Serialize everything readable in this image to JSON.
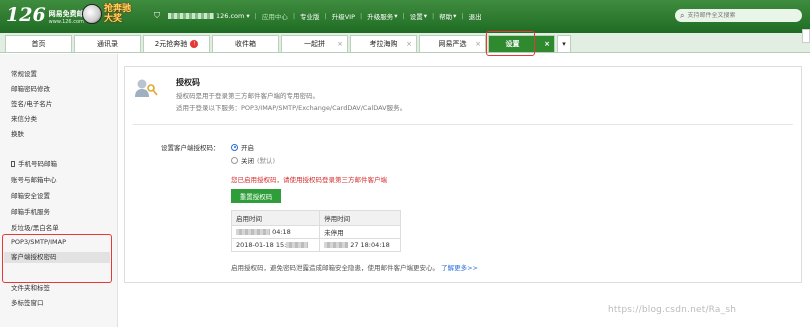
{
  "header": {
    "logo_number": "126",
    "logo_line1": "网易免费邮",
    "logo_line2": "www.126.com",
    "promo_text": "抢奔驰大奖",
    "user_suffix": "126.com",
    "user_caret": "▾",
    "links": [
      "应用中心",
      "专业版",
      "升级VIP",
      "升级服务",
      "设置",
      "帮助",
      "退出"
    ],
    "search_placeholder": "支持邮件全文搜索"
  },
  "tabs": [
    {
      "label": "首页",
      "closable": false
    },
    {
      "label": "通讯录",
      "closable": false
    },
    {
      "label": "2元抢奔驰",
      "closable": false,
      "badge": "●"
    },
    {
      "label": "收件箱",
      "closable": false
    },
    {
      "label": "一起拼",
      "closable": true
    },
    {
      "label": "考拉海购",
      "closable": true
    },
    {
      "label": "网易严选",
      "closable": true
    },
    {
      "label": "设置",
      "closable": true,
      "active": true
    }
  ],
  "tab_close_glyph": "×",
  "tab_more_glyph": "▾",
  "sidebar": {
    "items": [
      {
        "label": "常规设置"
      },
      {
        "label": "邮箱密码修改"
      },
      {
        "label": "签名/电子名片"
      },
      {
        "label": "来信分类"
      },
      {
        "label": "换肤"
      },
      {
        "label": "手机号码邮箱"
      },
      {
        "label": "账号与邮箱中心"
      },
      {
        "label": "邮箱安全设置"
      },
      {
        "label": "邮箱手机服务"
      },
      {
        "label": "反垃圾/黑白名单"
      },
      {
        "label": "POP3/SMTP/IMAP"
      },
      {
        "label": "客户端授权密码"
      },
      {
        "label": "文件夹和标签"
      },
      {
        "label": "多标签窗口"
      }
    ]
  },
  "auth": {
    "title": "授权码",
    "desc1": "授权码是用于登录第三方邮件客户端的专用密码。",
    "desc2": "适用于登录以下服务：POP3/IMAP/SMTP/Exchange/CardDAV/CalDAV服务。",
    "setting_label": "设置客户端授权码：",
    "option_on": "开启",
    "option_off": "关闭",
    "option_off_note": "(默认)",
    "warning": "您已启用授权码，请使用授权码登录第三方邮件客户端",
    "regen_button": "重置授权码",
    "table": {
      "headers": [
        "启用时间",
        "停用时间"
      ],
      "rows": [
        {
          "start_suffix": "04:18",
          "end": "未停用"
        },
        {
          "start_prefix": "2018-01-18 15:",
          "end_suffix": "27 18:04:18"
        }
      ]
    },
    "tip": "启用授权码，避免密码泄露造成邮箱安全隐患，使用邮件客户端更安心。",
    "tip_link": "了解更多>>"
  },
  "watermark": "https://blog.csdn.net/Ra_sh",
  "colors": {
    "header_green": "#2e7d32",
    "active_tab": "#2f8a2f",
    "button_green": "#2f9e3a",
    "warning_red": "#d32f2f",
    "link_blue": "#2b6cd8",
    "highlight_box": "#e53935"
  }
}
